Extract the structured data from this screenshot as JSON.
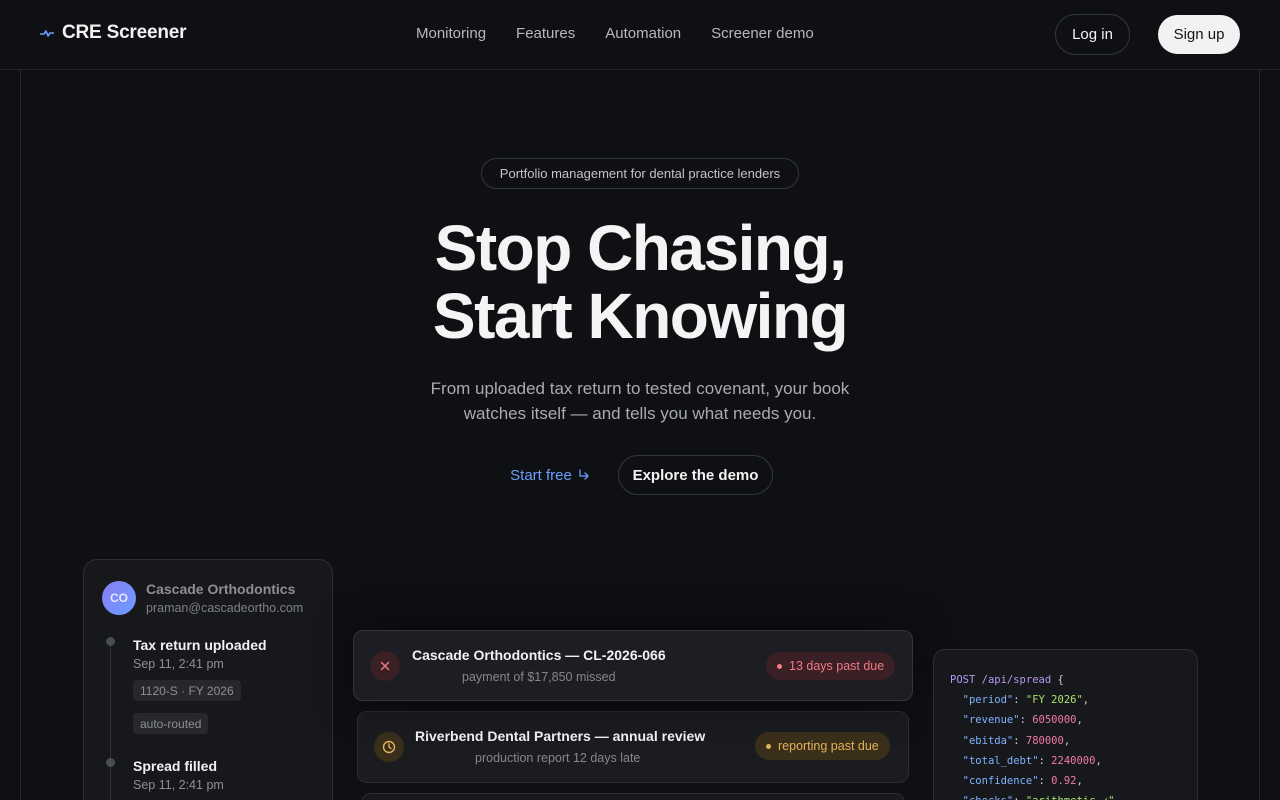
{
  "nav": {
    "brand": "CRE Screener",
    "links": [
      "Monitoring",
      "Features",
      "Automation",
      "Screener demo"
    ],
    "login": "Log in",
    "signup": "Sign up"
  },
  "hero": {
    "eyebrow": "Portfolio management for dental practice lenders",
    "headline_line1": "Stop Chasing,",
    "headline_line2": "Start Knowing",
    "subtitle": "From uploaded tax return to tested covenant, your book watches itself — and tells you what needs you.",
    "cta_primary": "Start free",
    "cta_primary_icon": "arrow-return-icon",
    "cta_secondary": "Explore the demo"
  },
  "timeline": {
    "initials": "CO",
    "client_name": "Cascade Orthodontics",
    "client_email": "praman@cascadeortho.com",
    "events": [
      {
        "title": "Tax return uploaded",
        "time": "Sep 11, 2:41 pm",
        "tags": [
          "1120-S · FY 2026",
          "auto-routed"
        ]
      },
      {
        "title": "Spread filled",
        "time": "Sep 11, 2:41 pm",
        "tags": []
      }
    ]
  },
  "alerts": [
    {
      "title": "Cascade Orthodontics — CL-2026-066",
      "desc": "payment of $17,850 missed",
      "status": "13 days past due",
      "icon": "x-icon",
      "tone": "danger"
    },
    {
      "title": "Riverbend Dental Partners — annual review",
      "desc": "production report 12 days late",
      "status": "reporting past due",
      "icon": "clock-icon",
      "tone": "warning"
    }
  ],
  "code": {
    "method": "POST",
    "path": "/api/spread",
    "fields": [
      {
        "key": "\"period\"",
        "value": "\"FY 2026\"",
        "type": "str"
      },
      {
        "key": "\"revenue\"",
        "value": "6050000",
        "type": "num"
      },
      {
        "key": "\"ebitda\"",
        "value": "780000",
        "type": "num"
      },
      {
        "key": "\"total_debt\"",
        "value": "2240000",
        "type": "num"
      },
      {
        "key": "\"confidence\"",
        "value": "0.92",
        "type": "num"
      },
      {
        "key": "\"checks\"",
        "value": "\"arithmetic ✓\"",
        "type": "str"
      }
    ]
  },
  "colors": {
    "accent": "#6b9dff",
    "danger": "#f07a84",
    "warning": "#e5b257",
    "background": "#0f1013"
  }
}
